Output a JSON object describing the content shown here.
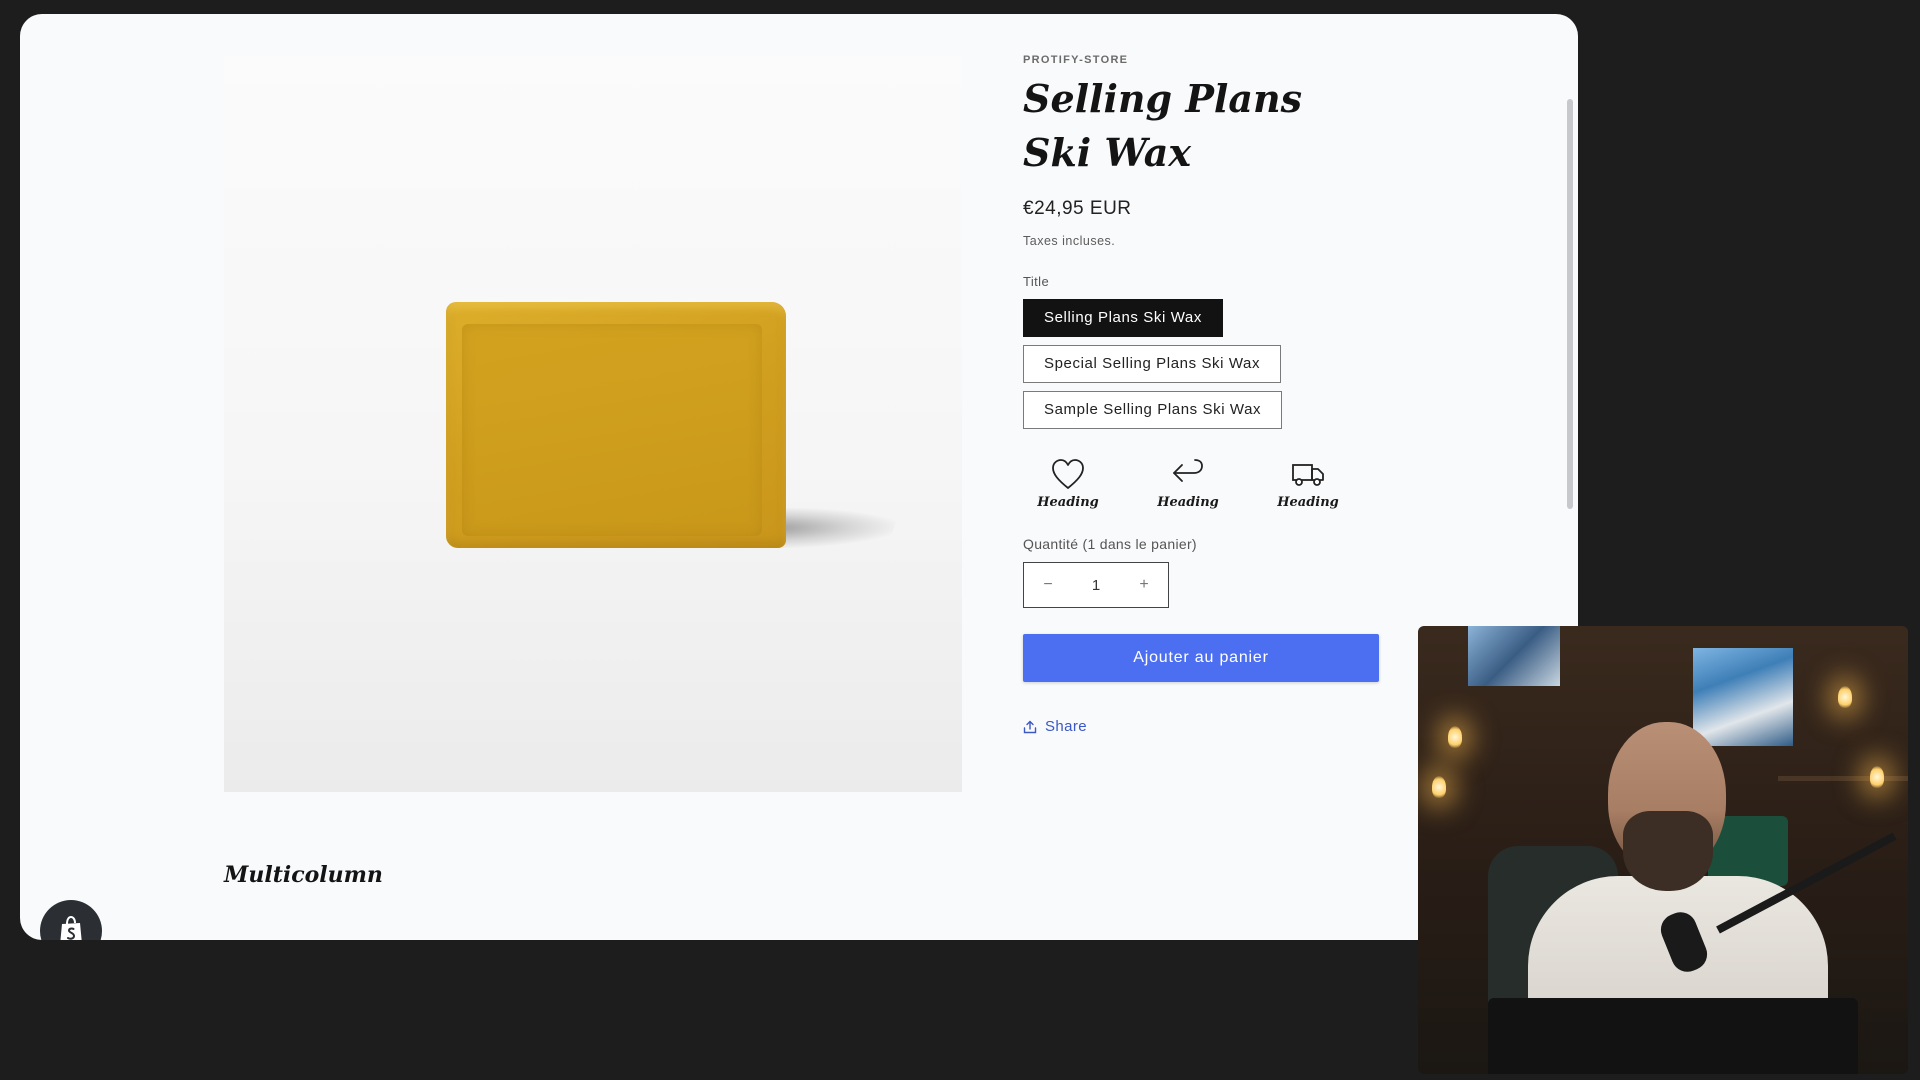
{
  "store": {
    "vendor": "PROTIFY-STORE"
  },
  "product": {
    "title": "Selling Plans Ski Wax",
    "price": "€24,95 EUR",
    "tax_note": "Taxes incluses.",
    "variant_legend": "Title",
    "variants": [
      {
        "label": "Selling Plans Ski Wax",
        "selected": true
      },
      {
        "label": "Special Selling Plans Ski Wax",
        "selected": false
      },
      {
        "label": "Sample Selling Plans Ski Wax",
        "selected": false
      }
    ],
    "features": [
      {
        "icon": "heart-icon",
        "label": "Heading"
      },
      {
        "icon": "return-arrow-icon",
        "label": "Heading"
      },
      {
        "icon": "truck-icon",
        "label": "Heading"
      }
    ],
    "quantity": {
      "label": "Quantité (1 dans le panier)",
      "value": "1",
      "decrement": "−",
      "increment": "+"
    },
    "add_to_cart": "Ajouter au panier",
    "share": "Share"
  },
  "sections": {
    "multicolumn_heading": "Multicolumn"
  },
  "colors": {
    "accent": "#4c6ff2",
    "selected_variant": "#121212",
    "link": "#3b58c4"
  }
}
